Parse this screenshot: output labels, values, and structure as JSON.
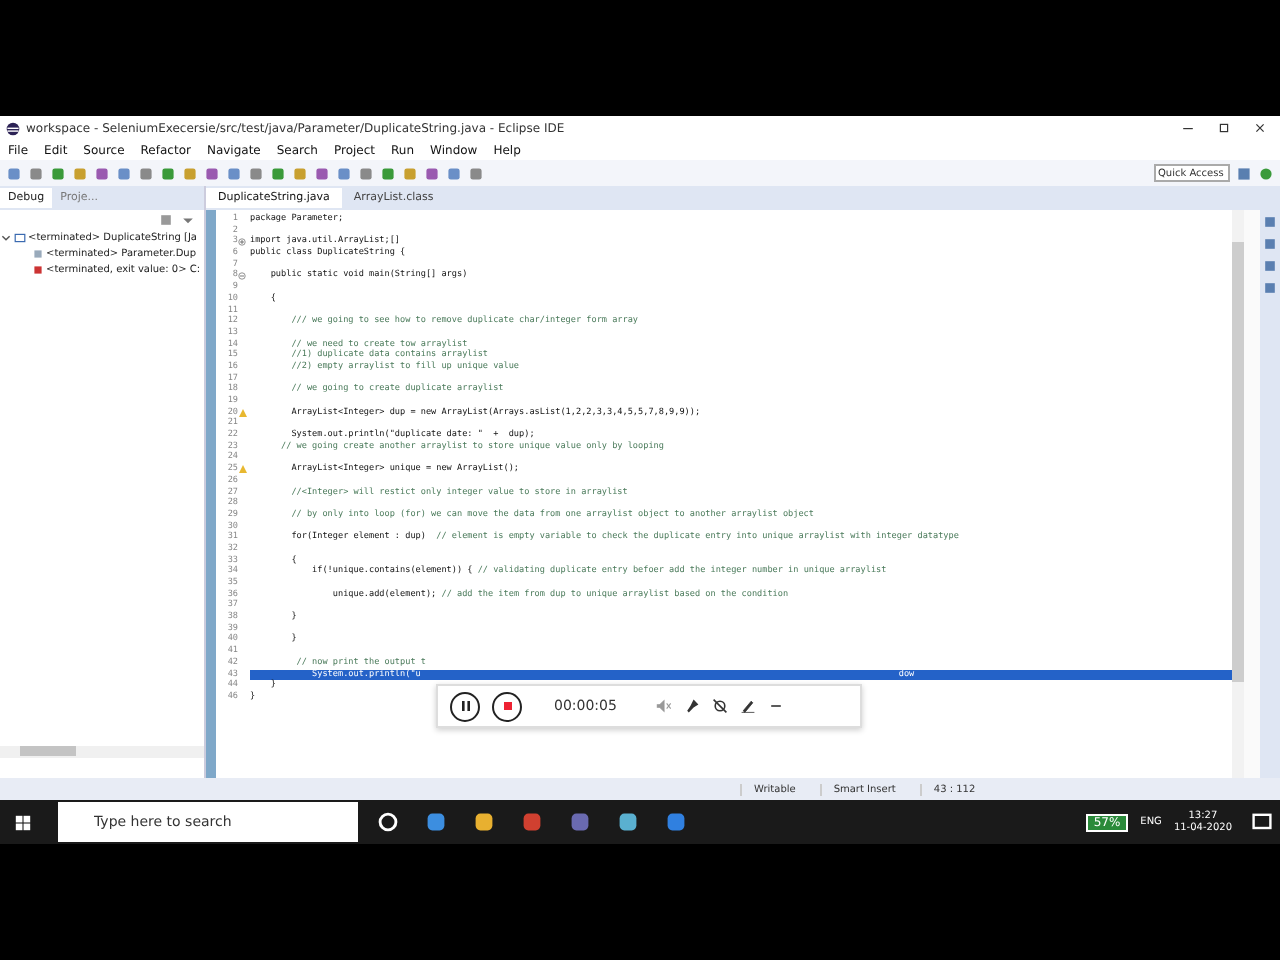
{
  "window": {
    "title": "workspace - SeleniumExecersie/src/test/java/Parameter/DuplicateString.java - Eclipse IDE"
  },
  "menu": [
    "File",
    "Edit",
    "Source",
    "Refactor",
    "Navigate",
    "Search",
    "Project",
    "Run",
    "Window",
    "Help"
  ],
  "quick_access": {
    "placeholder": "Quick Access"
  },
  "left_tabs": [
    {
      "label": "Debug",
      "selected": true
    },
    {
      "label": "Proje...",
      "selected": false
    }
  ],
  "debug_tree": [
    {
      "label": "<terminated> DuplicateString [Ja",
      "expanded": true,
      "children": [
        {
          "label": "<terminated> Parameter.Dup"
        },
        {
          "label": "<terminated, exit value: 0> C:"
        }
      ]
    }
  ],
  "editor_tabs": [
    {
      "label": "DuplicateString.java",
      "selected": true
    },
    {
      "label": "ArrayList.class",
      "selected": false
    }
  ],
  "lines": [
    {
      "number": "1",
      "code": "package Parameter;",
      "selected": false
    },
    {
      "number": "2",
      "selected": false
    },
    {
      "number": "3",
      "code": "import java.util.ArrayList;[]",
      "collapsed": true,
      "selected": false
    },
    {
      "number": "6",
      "code": "public class DuplicateString {",
      "selected": false
    },
    {
      "number": "7",
      "selected": false
    },
    {
      "number": "8",
      "code": "    public static void main(String[] args)",
      "collapsed": false,
      "selected": false
    },
    {
      "number": "9",
      "selected": false
    },
    {
      "number": "10",
      "code": "    {",
      "selected": false
    },
    {
      "number": "11",
      "selected": false
    },
    {
      "number": "12",
      "comment": "        /// we going to see how to remove duplicate char/integer form array",
      "selected": false
    },
    {
      "number": "13",
      "selected": false
    },
    {
      "number": "14",
      "comment": "        // we need to create tow arraylist",
      "selected": false
    },
    {
      "number": "15",
      "comment": "        //1) duplicate data contains arraylist",
      "selected": false
    },
    {
      "number": "16",
      "comment": "        //2) empty arraylist to fill up unique value",
      "selected": false
    },
    {
      "number": "17",
      "selected": false
    },
    {
      "number": "18",
      "comment": "        // we going to create duplicate arraylist",
      "selected": false
    },
    {
      "number": "19",
      "selected": false
    },
    {
      "number": "20",
      "code": "        ArrayList<Integer> dup = new ArrayList(Arrays.asList(1,2,2,3,3,4,5,5,7,8,9,9));",
      "warning": true,
      "selected": false
    },
    {
      "number": "21",
      "selected": false
    },
    {
      "number": "22",
      "code": "        System.out.println(\"duplicate date: \"  +  dup);",
      "selected": false
    },
    {
      "number": "23",
      "comment": "      // we going create another arraylist to store unique value only by looping",
      "selected": false
    },
    {
      "number": "24",
      "selected": false
    },
    {
      "number": "25",
      "code": "        ArrayList<Integer> unique = new ArrayList();",
      "warning": true,
      "selected": false
    },
    {
      "number": "26",
      "selected": false
    },
    {
      "number": "27",
      "comment": "        //<Integer> will restict only integer value to store in arraylist",
      "selected": false
    },
    {
      "number": "28",
      "selected": false
    },
    {
      "number": "29",
      "comment": "        // by only into loop (for) we can move the data from one arraylist object to another arraylist object",
      "selected": false
    },
    {
      "number": "30",
      "selected": false
    },
    {
      "number": "31",
      "code": "        for(Integer element : dup)",
      "comment": "  // element is empty variable to check the duplicate entry into unique arraylist with integer datatype",
      "selected": false
    },
    {
      "number": "32",
      "selected": false
    },
    {
      "number": "33",
      "code": "        {",
      "selected": false
    },
    {
      "number": "34",
      "code": "            if(!unique.contains(element)) {",
      "comment": " // validating duplicate entry befoer add the integer number in unique arraylist",
      "selected": false
    },
    {
      "number": "35",
      "selected": false
    },
    {
      "number": "36",
      "code": "                unique.add(element);",
      "comment": " // add the item from dup to unique arraylist based on the condition",
      "selected": false
    },
    {
      "number": "37",
      "selected": false
    },
    {
      "number": "38",
      "code": "        }",
      "selected": false
    },
    {
      "number": "39",
      "selected": false
    },
    {
      "number": "40",
      "code": "        }",
      "selected": false
    },
    {
      "number": "41",
      "selected": false
    },
    {
      "number": "42",
      "comment": "         // now print the output t",
      "selected": false
    },
    {
      "number": "43",
      "code": "            System.out.println(\"u",
      "tail": "dow",
      "selected": true
    },
    {
      "number": "44",
      "code": "    }",
      "selected": false
    },
    {
      "number": "46",
      "code": "}",
      "selected": false
    }
  ],
  "recorder": {
    "time": "00:00:05"
  },
  "status_bar": [
    "Writable",
    "Smart Insert",
    "43 : 112"
  ],
  "taskbar": {
    "search": {
      "placeholder": "Type here to search"
    },
    "battery": "57%",
    "language": "ENG",
    "time": "13:27",
    "date": "11-04-2020"
  }
}
